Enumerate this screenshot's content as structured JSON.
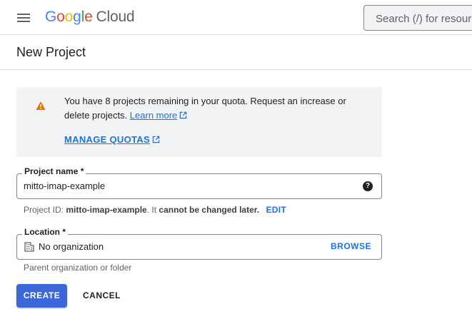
{
  "header": {
    "logo": {
      "g1": "G",
      "o1": "o",
      "o2": "o",
      "g2": "g",
      "l": "l",
      "e": "e",
      "product": "Cloud"
    },
    "search_text": "Search (/) for resources"
  },
  "page": {
    "title": "New Project"
  },
  "quota": {
    "message": "You have 8 projects remaining in your quota. Request an increase or delete projects.",
    "learn_more": "Learn more",
    "manage_quotas": "MANAGE QUOTAS"
  },
  "project_name": {
    "label": "Project name *",
    "value": "mitto-imap-example",
    "help_glyph": "?"
  },
  "project_id_hint": {
    "prefix": "Project ID: ",
    "id": "mitto-imap-example",
    "middle": ". It ",
    "bold": "cannot be changed later.",
    "edit": "EDIT"
  },
  "location": {
    "label": "Location *",
    "value": "No organization",
    "browse": "BROWSE",
    "hint": "Parent organization or folder"
  },
  "actions": {
    "create": "CREATE",
    "cancel": "CANCEL"
  },
  "colors": {
    "primary": "#3b67d8",
    "link": "#1a73e8",
    "warning": "#e37400"
  }
}
